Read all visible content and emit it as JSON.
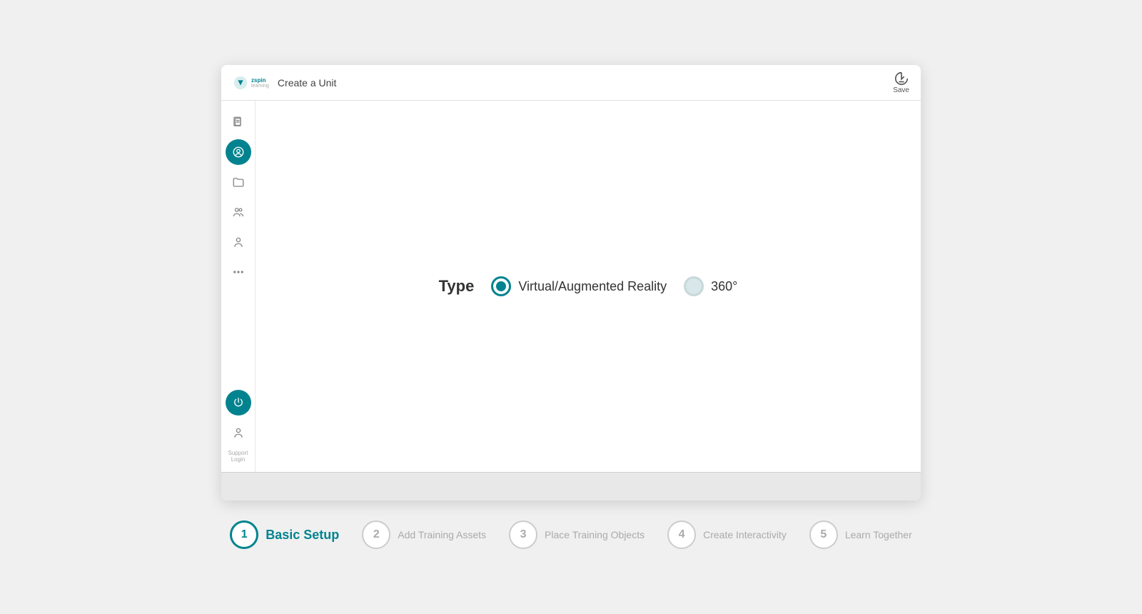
{
  "header": {
    "title": "Create a Unit",
    "save_label": "Save"
  },
  "sidebar": {
    "items": [
      {
        "name": "pages-icon",
        "active": false
      },
      {
        "name": "users-circle-icon",
        "active": true
      },
      {
        "name": "folder-icon",
        "active": false
      },
      {
        "name": "people-icon",
        "active": false
      },
      {
        "name": "person-icon",
        "active": false
      },
      {
        "name": "more-icon",
        "active": false
      }
    ],
    "bottom": [
      {
        "name": "power-icon",
        "active": false
      },
      {
        "name": "user-icon",
        "active": false
      }
    ],
    "support_line1": "Support",
    "support_line2": "Login"
  },
  "main": {
    "type_label": "Type",
    "options": [
      {
        "value": "vr",
        "label": "Virtual/Augmented Reality",
        "selected": true
      },
      {
        "value": "360",
        "label": "360°",
        "selected": false
      }
    ]
  },
  "stepper": {
    "steps": [
      {
        "number": "1",
        "label": "Basic Setup",
        "active": true
      },
      {
        "number": "2",
        "label": "Add Training Assets",
        "active": false
      },
      {
        "number": "3",
        "label": "Place Training Objects",
        "active": false
      },
      {
        "number": "4",
        "label": "Create Interactivity",
        "active": false
      },
      {
        "number": "5",
        "label": "Learn Together",
        "active": false
      }
    ]
  },
  "logo": {
    "line1": "zspin",
    "line2": "learning"
  }
}
